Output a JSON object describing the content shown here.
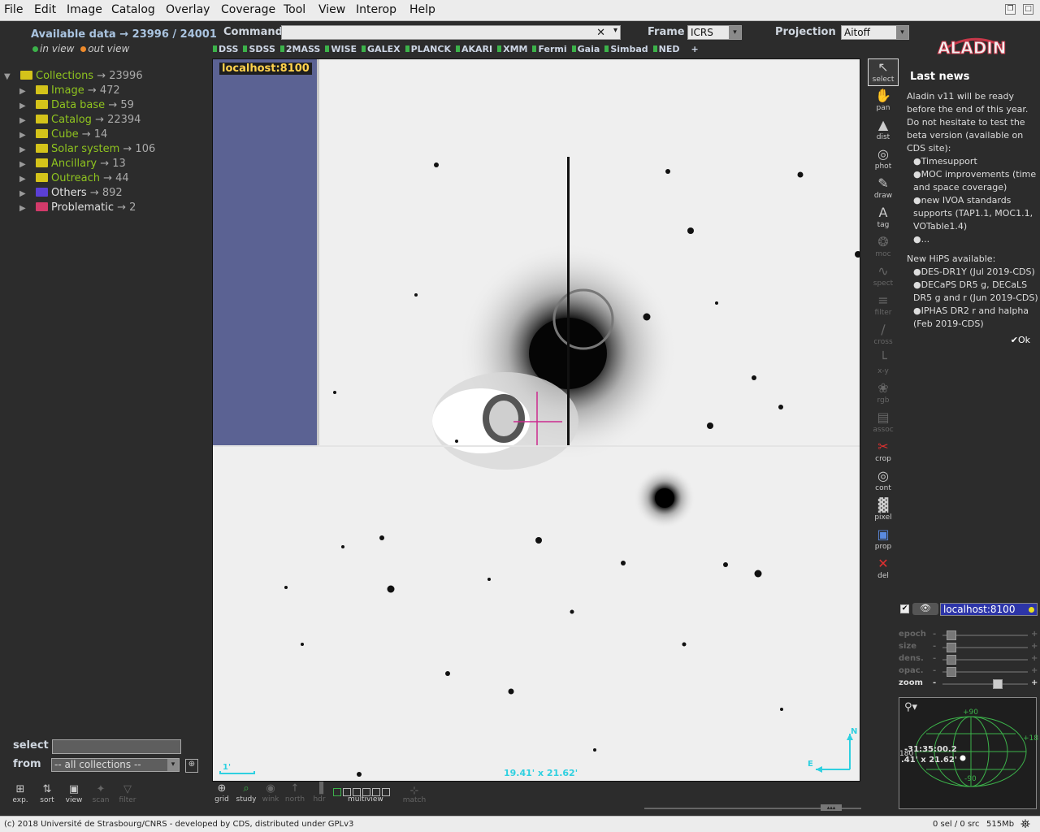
{
  "menu": [
    "File",
    "Edit",
    "Image",
    "Catalog",
    "Overlay",
    "Coverage",
    "Tool",
    "View",
    "Interop",
    "Help"
  ],
  "available": {
    "label": "Available data → 23996 / 24001",
    "in_view": "in view",
    "out_view": "out view"
  },
  "tree": [
    {
      "label": "Collections",
      "count": "→ 23996",
      "color": "#d4c31a",
      "root": true
    },
    {
      "label": "Image",
      "count": "→ 472",
      "color": "#d4c31a"
    },
    {
      "label": "Data base",
      "count": "→ 59",
      "color": "#d4c31a"
    },
    {
      "label": "Catalog",
      "count": "→ 22394",
      "color": "#d4c31a"
    },
    {
      "label": "Cube",
      "count": "→ 14",
      "color": "#d4c31a"
    },
    {
      "label": "Solar system",
      "count": "→ 106",
      "color": "#d4c31a"
    },
    {
      "label": "Ancillary",
      "count": "→ 13",
      "color": "#d4c31a"
    },
    {
      "label": "Outreach",
      "count": "→ 44",
      "color": "#d4c31a"
    },
    {
      "label": "Others",
      "count": "→ 892",
      "color": "#5b3fd6",
      "white": true
    },
    {
      "label": "Problematic",
      "count": "→ 2",
      "color": "#d23a6a",
      "white": true
    }
  ],
  "command_label": "Command",
  "frame_label": "Frame",
  "frame_value": "ICRS",
  "projection_label": "Projection",
  "projection_value": "Aitoff",
  "surveys": [
    "DSS",
    "SDSS",
    "2MASS",
    "WISE",
    "GALEX",
    "PLANCK",
    "AKARI",
    "XMM",
    "Fermi",
    "Gaia",
    "Simbad",
    "NED"
  ],
  "add_survey": "+",
  "logo_text": "ALADIN",
  "view": {
    "label": "localhost:8100",
    "fov": "19.41' x 21.62'",
    "scale": "1'",
    "north": "N",
    "east": "E"
  },
  "tools": [
    {
      "name": "select",
      "icon": "↖"
    },
    {
      "name": "pan",
      "icon": "✋"
    },
    {
      "name": "dist",
      "icon": "▲"
    },
    {
      "name": "phot",
      "icon": "◎"
    },
    {
      "name": "draw",
      "icon": "✎"
    },
    {
      "name": "tag",
      "icon": "A"
    },
    {
      "name": "moc",
      "icon": "❂",
      "dim": true
    },
    {
      "name": "spect",
      "icon": "∿",
      "dim": true
    },
    {
      "name": "filter",
      "icon": "≡",
      "dim": true
    },
    {
      "name": "cross",
      "icon": "∕",
      "dim": true
    },
    {
      "name": "x-y",
      "icon": "└",
      "dim": true
    },
    {
      "name": "rgb",
      "icon": "❀",
      "dim": true
    },
    {
      "name": "assoc",
      "icon": "▤",
      "dim": true
    },
    {
      "name": "crop",
      "icon": "✂"
    },
    {
      "name": "cont",
      "icon": "◎"
    },
    {
      "name": "pixel",
      "icon": "▓"
    },
    {
      "name": "prop",
      "icon": "▣"
    },
    {
      "name": "del",
      "icon": "✕"
    }
  ],
  "news": {
    "title": "Last news",
    "lines": [
      "Aladin v11 will be ready before the end of this year. Do not hesitate to test the beta version (available on CDS site):",
      "●Timesupport",
      "●MOC improvements (time and space coverage)",
      "●new IVOA standards supports (TAP1.1, MOC1.1, VOTable1.4)",
      "●...",
      "New HiPS available:",
      "●DES-DR1Y (Jul 2019-CDS)",
      "●DECaPS DR5 g, DECaLS DR5 g and r (Jun 2019-CDS)",
      "●IPHAS DR2 r and halpha (Feb 2019-CDS)"
    ],
    "ok": "✔Ok"
  },
  "layer": {
    "label": "localhost:8100"
  },
  "sliders": [
    {
      "label": "epoch",
      "level": 0.05
    },
    {
      "label": "size",
      "level": 0.05
    },
    {
      "label": "dens.",
      "level": 0.05
    },
    {
      "label": "opac.",
      "level": 0.05
    },
    {
      "label": "zoom",
      "level": 0.67,
      "active": true
    }
  ],
  "minimap": {
    "lat_top": "+90",
    "lat_bottom": "-90",
    "lon_right": "+18",
    "dec": "-31:35:00.2",
    "size": ".41' x 21.62'",
    "side": "180"
  },
  "select_label": "select",
  "from_label": "from",
  "from_value": "-- all collections --",
  "left_tools": [
    {
      "name": "exp.",
      "icon": "⊞"
    },
    {
      "name": "sort",
      "icon": "⇅"
    },
    {
      "name": "view",
      "icon": "▣"
    },
    {
      "name": "scan",
      "icon": "✦",
      "dim": true
    },
    {
      "name": "filter",
      "icon": "▽",
      "dim": true
    }
  ],
  "bottom_tools": [
    {
      "name": "grid",
      "icon": "⊕"
    },
    {
      "name": "study",
      "icon": "⌕"
    },
    {
      "name": "wink",
      "icon": "◉",
      "dim": true
    },
    {
      "name": "north",
      "icon": "↑",
      "dim": true
    },
    {
      "name": "hdr",
      "icon": "▐",
      "dim": true
    }
  ],
  "multiview_label": "multiview",
  "match_label": "match",
  "status": {
    "copyright": "(c) 2018 Université de Strasbourg/CNRS - developed by CDS, distributed under GPLv3",
    "sel": "0 sel / 0 src",
    "mem": "515Mb"
  }
}
